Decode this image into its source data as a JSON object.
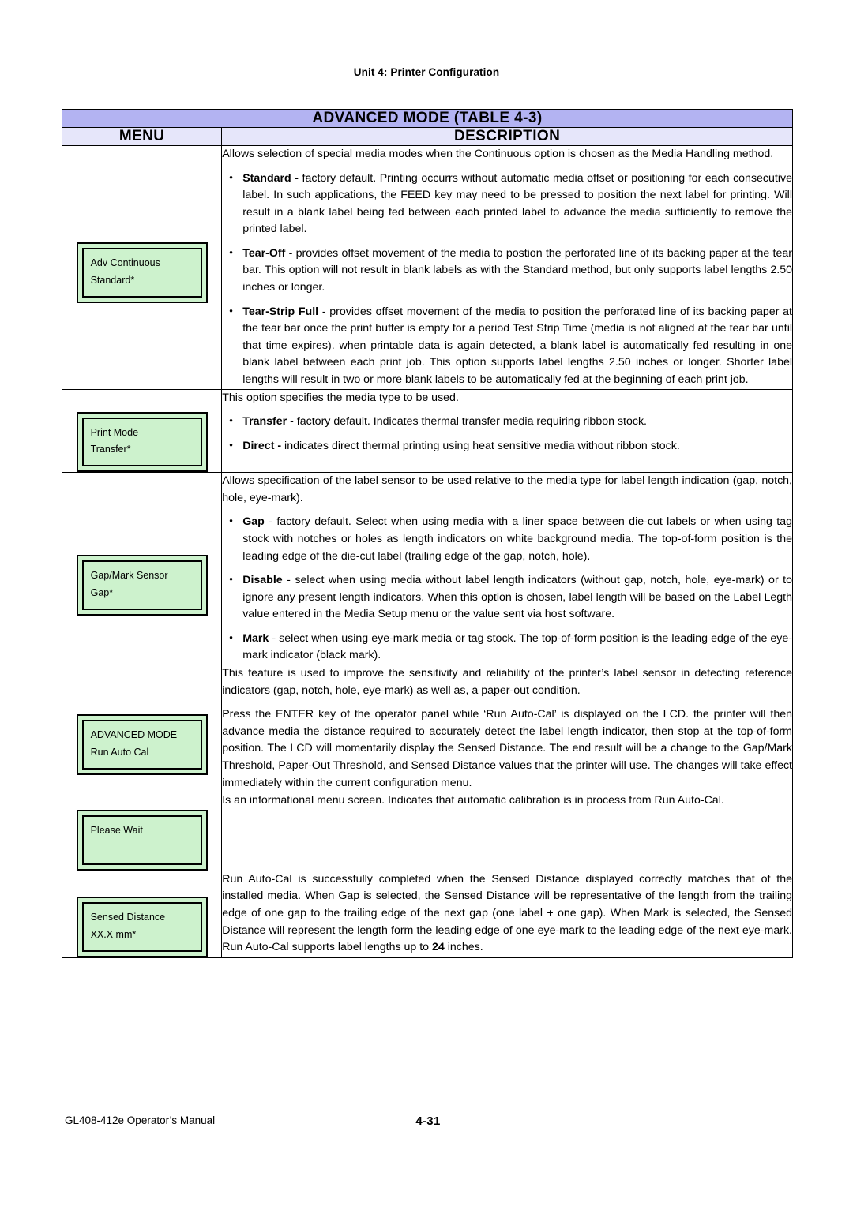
{
  "running_head": "Unit 4:  Printer Configuration",
  "table": {
    "title": "ADVANCED MODE (TABLE 4-3)",
    "headers": {
      "menu": "MENU",
      "description": "DESCRIPTION"
    },
    "colors": {
      "title_bg": "#b3b3f2",
      "header_bg": "#e6e6fa",
      "lcd_bg": "#cdf2cd",
      "border": "#000000"
    },
    "rows": [
      {
        "menu": {
          "name": "lcd-adv-continuous",
          "line1": "Adv Continuous",
          "line2": "Standard*"
        },
        "description": {
          "intro": "Allows selection of special media modes when the Continuous option is chosen as the Media Handling method.",
          "bullets": [
            {
              "term": "Standard",
              "text": " - factory default. Printing occurrs without automatic media offset or positioning for each consecutive label. In such applications, the FEED key may need to be pressed to position the next label for printing. Will result in a blank label being fed between each printed label to advance the media sufficiently to remove the printed label."
            },
            {
              "term": "Tear-Off",
              "text": " -  provides offset movement of the media to postion the perforated line of its backing paper at the tear bar. This option will not result in blank labels as with the Standard method, but only supports label lengths 2.50 inches or longer."
            },
            {
              "term": "Tear-Strip Full",
              "text": " - provides offset movement of the media to position the perforated line of its backing paper at the tear bar once the print buffer is empty for a period Test Strip Time (media is not aligned at the tear bar until that time expires). when printable data is again detected, a blank label is automatically fed resulting in one blank label between each print job. This option supports label lengths 2.50 inches or longer. Shorter label lengths will result in two or more blank labels to be automatically fed at the beginning of each print job."
            }
          ]
        }
      },
      {
        "menu": {
          "name": "lcd-print-mode",
          "line1": "Print Mode",
          "line2": "Transfer*"
        },
        "description": {
          "intro": "This option specifies the media type to be used.",
          "bullets": [
            {
              "term": "Transfer",
              "text": " - factory default. Indicates thermal transfer media requiring ribbon stock."
            },
            {
              "term": "Direct -",
              "text": "  indicates direct thermal printing using heat sensitive media without ribbon stock."
            }
          ]
        }
      },
      {
        "menu": {
          "name": "lcd-gap-mark-sensor",
          "line1": "Gap/Mark Sensor",
          "line2": "Gap*"
        },
        "description": {
          "intro": "Allows specification of the label sensor to be used relative to the media type for label length indication (gap, notch, hole, eye-mark).",
          "bullets": [
            {
              "term": "Gap",
              "text": " - factory default. Select when using media with a liner space between die-cut labels or when using tag stock with notches or holes as length indicators on white background media. The top-of-form position is the leading edge of the die-cut label (trailing edge of the gap, notch, hole)."
            },
            {
              "term": "Disable",
              "text": " -  select when using media without label length indicators (without gap, notch, hole, eye-mark) or to ignore any present length indicators. When this option is chosen, label length will be based on the Label Legth value entered in the Media Setup menu or the value sent via host software."
            },
            {
              "term": "Mark",
              "text": " - select when using eye-mark media or tag stock. The top-of-form position is the leading edge of the eye-mark indicator (black mark)."
            }
          ]
        }
      },
      {
        "menu": {
          "name": "lcd-advanced-mode",
          "line1": "ADVANCED MODE",
          "line2": "Run Auto Cal"
        },
        "description": {
          "paragraphs": [
            "This feature is used to improve the sensitivity and reliability of the printer’s label sensor in detecting reference indicators (gap, notch, hole, eye-mark) as well as, a paper-out condition.",
            "Press the ENTER key of the operator panel while ‘Run Auto-Cal’ is displayed on the LCD. the printer will then advance media the distance required to accurately detect the label length indicator, then stop at the top-of-form position. The LCD will momentarily display the Sensed Distance. The end result will be a change to the Gap/Mark Threshold, Paper-Out Threshold, and Sensed Distance values that the printer will use. The changes will take effect immediately within the current configuration menu."
          ]
        }
      },
      {
        "menu": {
          "name": "lcd-please-wait",
          "line1": "Please Wait",
          "line2": ""
        },
        "description": {
          "paragraphs": [
            "Is an informational menu screen. Indicates that automatic calibration is in process from Run Auto-Cal."
          ]
        }
      },
      {
        "menu": {
          "name": "lcd-sensed-distance",
          "line1": "Sensed Distance",
          "line2": "XX.X  mm*"
        },
        "description": {
          "rich": {
            "part1": "Run Auto-Cal is successfully completed when the Sensed Distance displayed correctly matches that of the installed media. When Gap is selected, the Sensed Distance will be representative of the length from the trailing edge of one gap to the trailing edge of the next gap (one label + one gap). When Mark is selected, the Sensed Distance will represent the length form the leading edge of one eye-mark to the leading edge of the next eye-mark. Run Auto-Cal supports label lengths up to ",
            "bold": "24",
            "part2": " inches."
          }
        }
      }
    ]
  },
  "footer": {
    "manual": "GL408-412e Operator’s Manual",
    "page_number": "4-31"
  }
}
